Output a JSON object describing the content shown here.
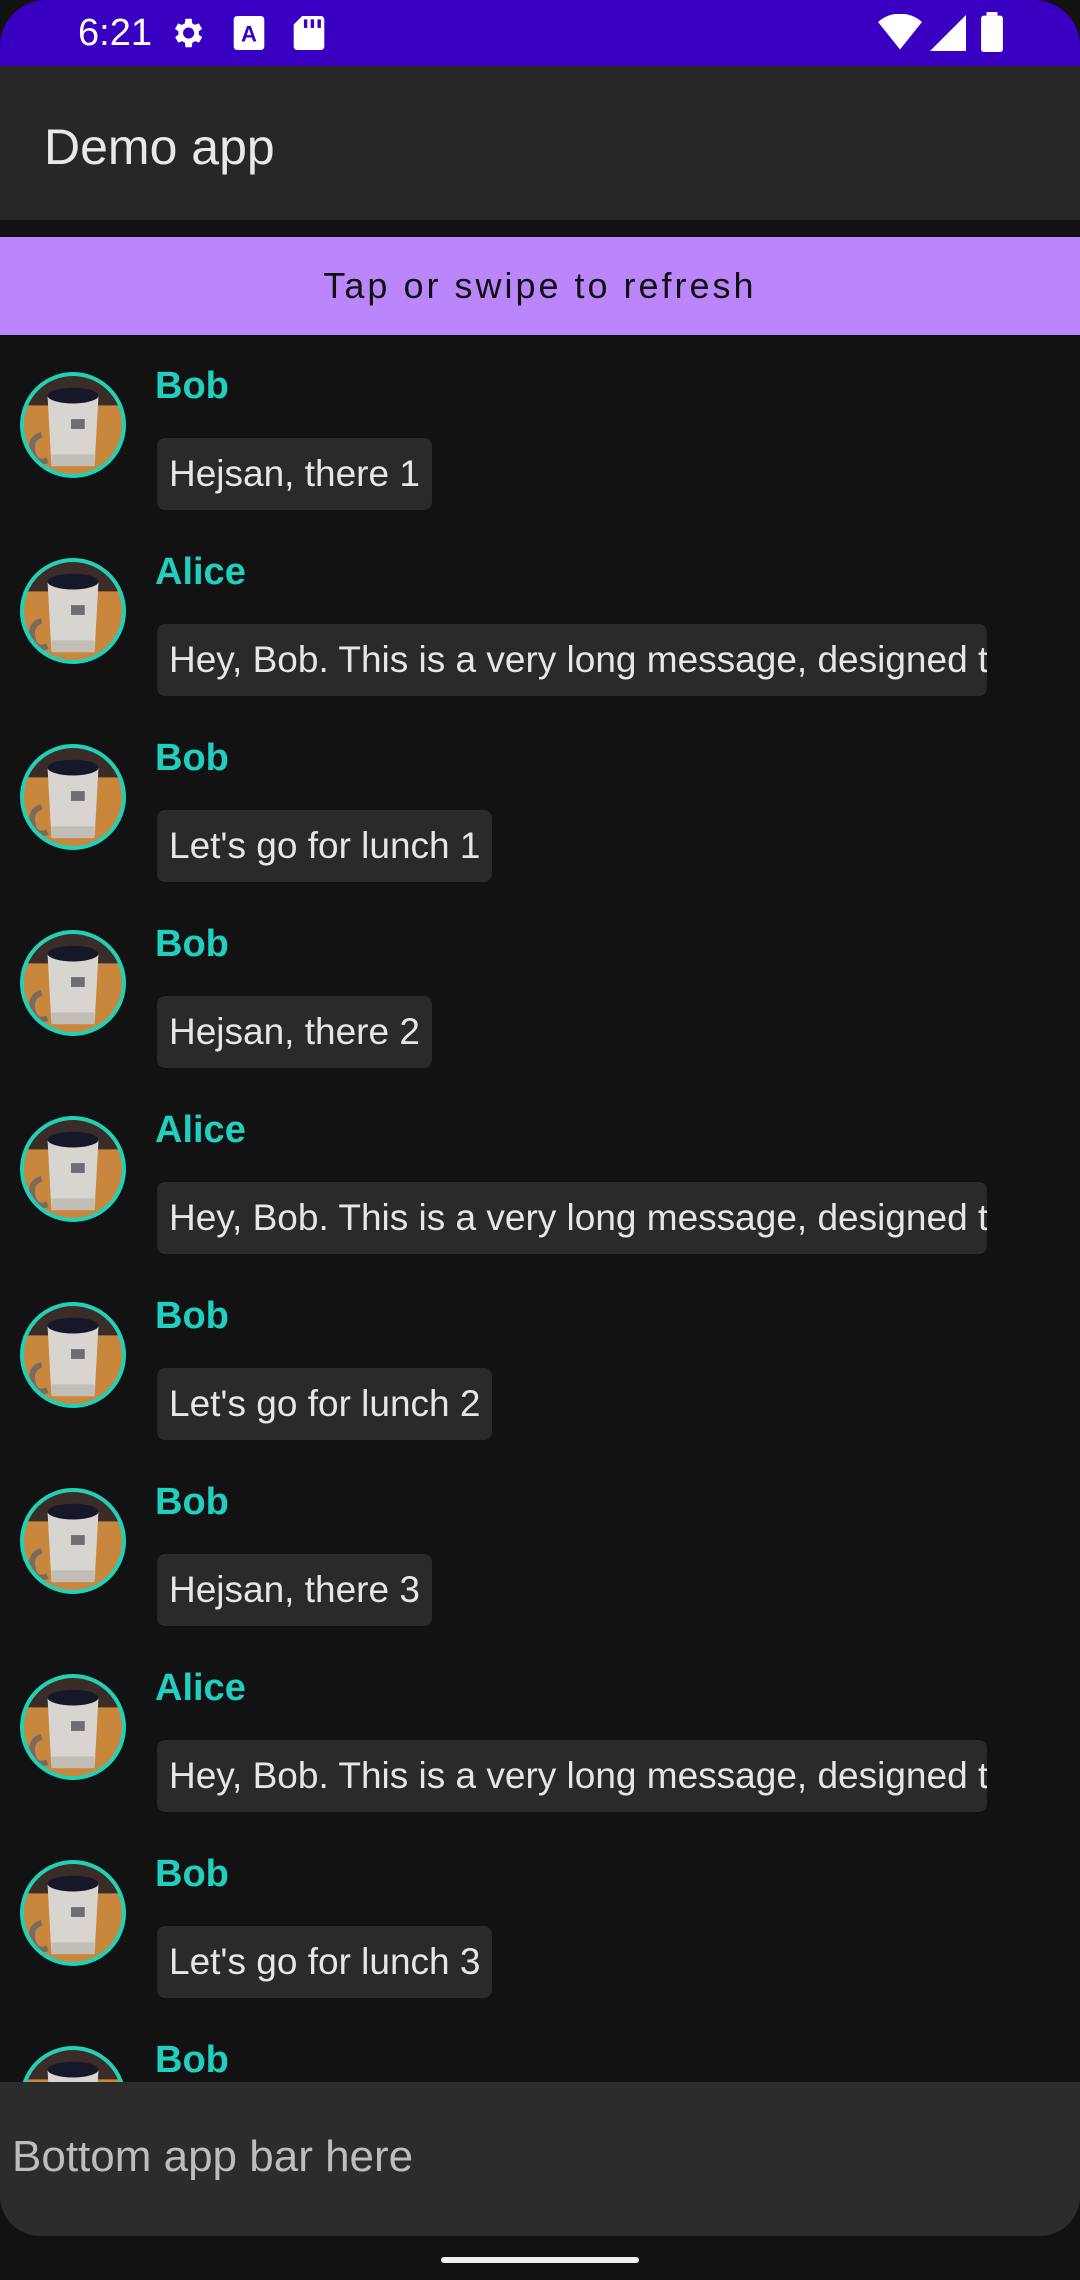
{
  "status_bar": {
    "time": "6:21",
    "left_icons": [
      "gear-icon",
      "font-a-icon",
      "sd-card-icon"
    ],
    "right_icons": [
      "wifi-icon",
      "signal-icon",
      "battery-icon"
    ],
    "color": "#3a00c2"
  },
  "app_bar": {
    "title": "Demo app"
  },
  "refresh": {
    "label": "Tap or swipe to refresh",
    "color": "#bb86fc"
  },
  "messages": [
    {
      "author": "Bob",
      "text": "Hejsan, there 1"
    },
    {
      "author": "Alice",
      "text": "Hey, Bob. This is a very long message, designed to"
    },
    {
      "author": "Bob",
      "text": "Let's go for lunch 1"
    },
    {
      "author": "Bob",
      "text": "Hejsan, there 2"
    },
    {
      "author": "Alice",
      "text": "Hey, Bob. This is a very long message, designed to"
    },
    {
      "author": "Bob",
      "text": "Let's go for lunch 2"
    },
    {
      "author": "Bob",
      "text": "Hejsan, there 3"
    },
    {
      "author": "Alice",
      "text": "Hey, Bob. This is a very long message, designed to"
    },
    {
      "author": "Bob",
      "text": "Let's go for lunch 3"
    },
    {
      "author": "Bob",
      "text": ""
    }
  ],
  "bottom_bar": {
    "placeholder": "Bottom app bar here"
  },
  "accent_color": "#1ed1b9"
}
